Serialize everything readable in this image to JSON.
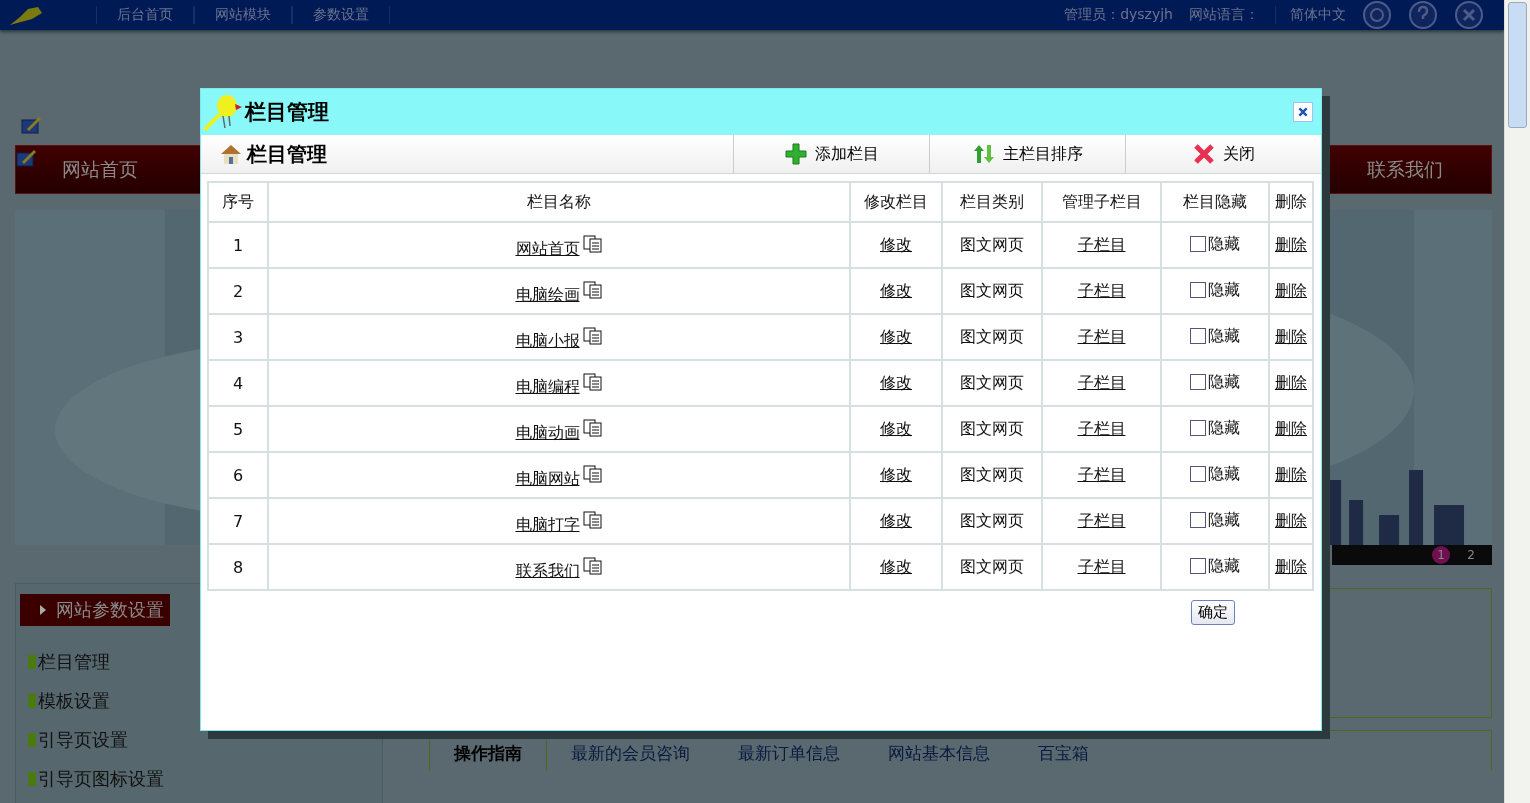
{
  "topbar": {
    "nav": [
      "后台首页",
      "网站模块",
      "参数设置"
    ],
    "admin": "管理员：dyszyjh",
    "language_label": "网站语言：",
    "language": "简体中文"
  },
  "page_nav": {
    "items": [
      "网站首页",
      "联系我们"
    ]
  },
  "banner": {
    "pages": [
      {
        "label": "1",
        "selected": true
      },
      {
        "label": "2",
        "selected": false
      }
    ]
  },
  "side_panel": {
    "title": "网站参数设置",
    "items": [
      "栏目管理",
      "模板设置",
      "引导页设置",
      "引导页图标设置"
    ]
  },
  "bottom_tabs": [
    {
      "label": "操作指南",
      "selected": true
    },
    {
      "label": "最新的会员咨询",
      "selected": false
    },
    {
      "label": "最新订单信息",
      "selected": false
    },
    {
      "label": "网站基本信息",
      "selected": false
    },
    {
      "label": "百宝箱",
      "selected": false
    }
  ],
  "dialog": {
    "title": "栏目管理",
    "toolbar": {
      "title": "栏目管理",
      "buttons": [
        {
          "kind": "add",
          "label": "添加栏目"
        },
        {
          "kind": "sort",
          "label": "主栏目排序"
        },
        {
          "kind": "close",
          "label": "关闭"
        }
      ]
    },
    "table": {
      "columns": [
        "序号",
        "栏目名称",
        "修改栏目",
        "栏目类别",
        "管理子栏目",
        "栏目隐藏",
        "删除"
      ],
      "rows": [
        {
          "index": "1",
          "name": "网站首页",
          "edit": "修改",
          "type": "图文网页",
          "sub": "子栏目",
          "hidden": false,
          "hide_label": "隐藏",
          "delete": "删除"
        },
        {
          "index": "2",
          "name": "电脑绘画",
          "edit": "修改",
          "type": "图文网页",
          "sub": "子栏目",
          "hidden": false,
          "hide_label": "隐藏",
          "delete": "删除"
        },
        {
          "index": "3",
          "name": "电脑小报",
          "edit": "修改",
          "type": "图文网页",
          "sub": "子栏目",
          "hidden": false,
          "hide_label": "隐藏",
          "delete": "删除"
        },
        {
          "index": "4",
          "name": "电脑编程",
          "edit": "修改",
          "type": "图文网页",
          "sub": "子栏目",
          "hidden": false,
          "hide_label": "隐藏",
          "delete": "删除"
        },
        {
          "index": "5",
          "name": "电脑动画",
          "edit": "修改",
          "type": "图文网页",
          "sub": "子栏目",
          "hidden": false,
          "hide_label": "隐藏",
          "delete": "删除"
        },
        {
          "index": "6",
          "name": "电脑网站",
          "edit": "修改",
          "type": "图文网页",
          "sub": "子栏目",
          "hidden": false,
          "hide_label": "隐藏",
          "delete": "删除"
        },
        {
          "index": "7",
          "name": "电脑打字",
          "edit": "修改",
          "type": "图文网页",
          "sub": "子栏目",
          "hidden": false,
          "hide_label": "隐藏",
          "delete": "删除"
        },
        {
          "index": "8",
          "name": "联系我们",
          "edit": "修改",
          "type": "图文网页",
          "sub": "子栏目",
          "hidden": false,
          "hide_label": "隐藏",
          "delete": "删除"
        }
      ]
    },
    "confirm": "确定"
  }
}
